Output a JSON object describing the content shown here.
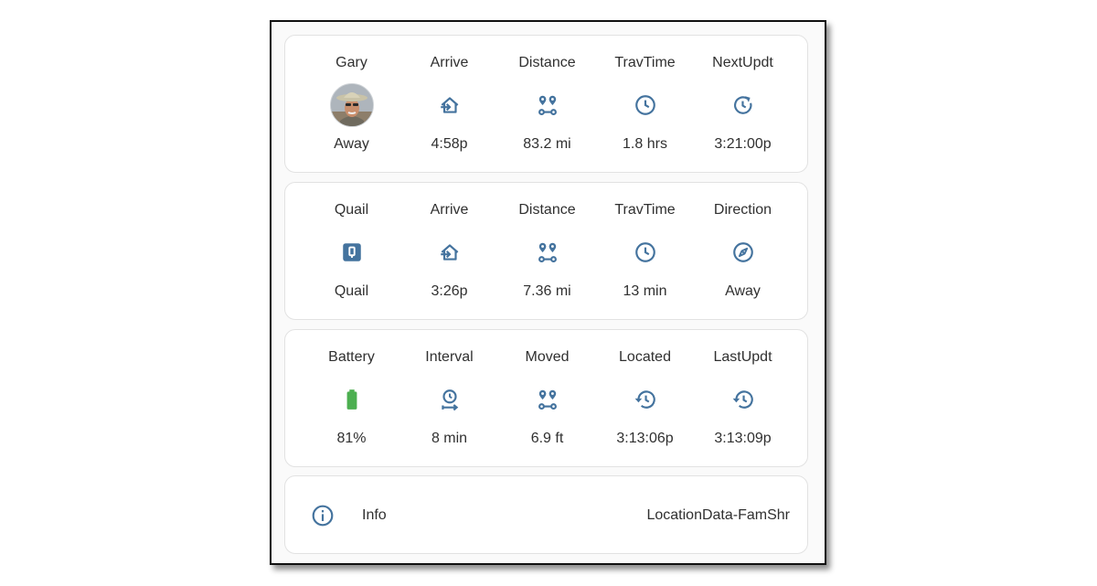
{
  "colors": {
    "icon": "#44739e",
    "battery": "#4caf50",
    "text": "#303030"
  },
  "rows": [
    {
      "cells": [
        {
          "label": "Gary",
          "icon": "person-avatar",
          "value": "Away"
        },
        {
          "label": "Arrive",
          "icon": "arrive-home-icon",
          "value": "4:58p"
        },
        {
          "label": "Distance",
          "icon": "map-marker-distance-icon",
          "value": "83.2 mi"
        },
        {
          "label": "TravTime",
          "icon": "clock-icon",
          "value": "1.8 hrs"
        },
        {
          "label": "NextUpdt",
          "icon": "clock-refresh-icon",
          "value": "3:21:00p"
        }
      ]
    },
    {
      "cells": [
        {
          "label": "Quail",
          "icon": "zone-box-icon",
          "icon_text": "Q",
          "value": "Quail"
        },
        {
          "label": "Arrive",
          "icon": "arrive-home-icon",
          "value": "3:26p"
        },
        {
          "label": "Distance",
          "icon": "map-marker-distance-icon",
          "value": "7.36 mi"
        },
        {
          "label": "TravTime",
          "icon": "clock-icon",
          "value": "13 min"
        },
        {
          "label": "Direction",
          "icon": "compass-icon",
          "value": "Away"
        }
      ]
    },
    {
      "cells": [
        {
          "label": "Battery",
          "icon": "battery-icon",
          "value": "81%"
        },
        {
          "label": "Interval",
          "icon": "timer-interval-icon",
          "value": "8 min"
        },
        {
          "label": "Moved",
          "icon": "map-marker-distance-icon",
          "value": "6.9 ft"
        },
        {
          "label": "Located",
          "icon": "history-icon",
          "value": "3:13:06p"
        },
        {
          "label": "LastUpdt",
          "icon": "history-icon",
          "value": "3:13:09p"
        }
      ]
    }
  ],
  "info": {
    "icon": "information-outline-icon",
    "label": "Info",
    "value": "LocationData-FamShr"
  }
}
